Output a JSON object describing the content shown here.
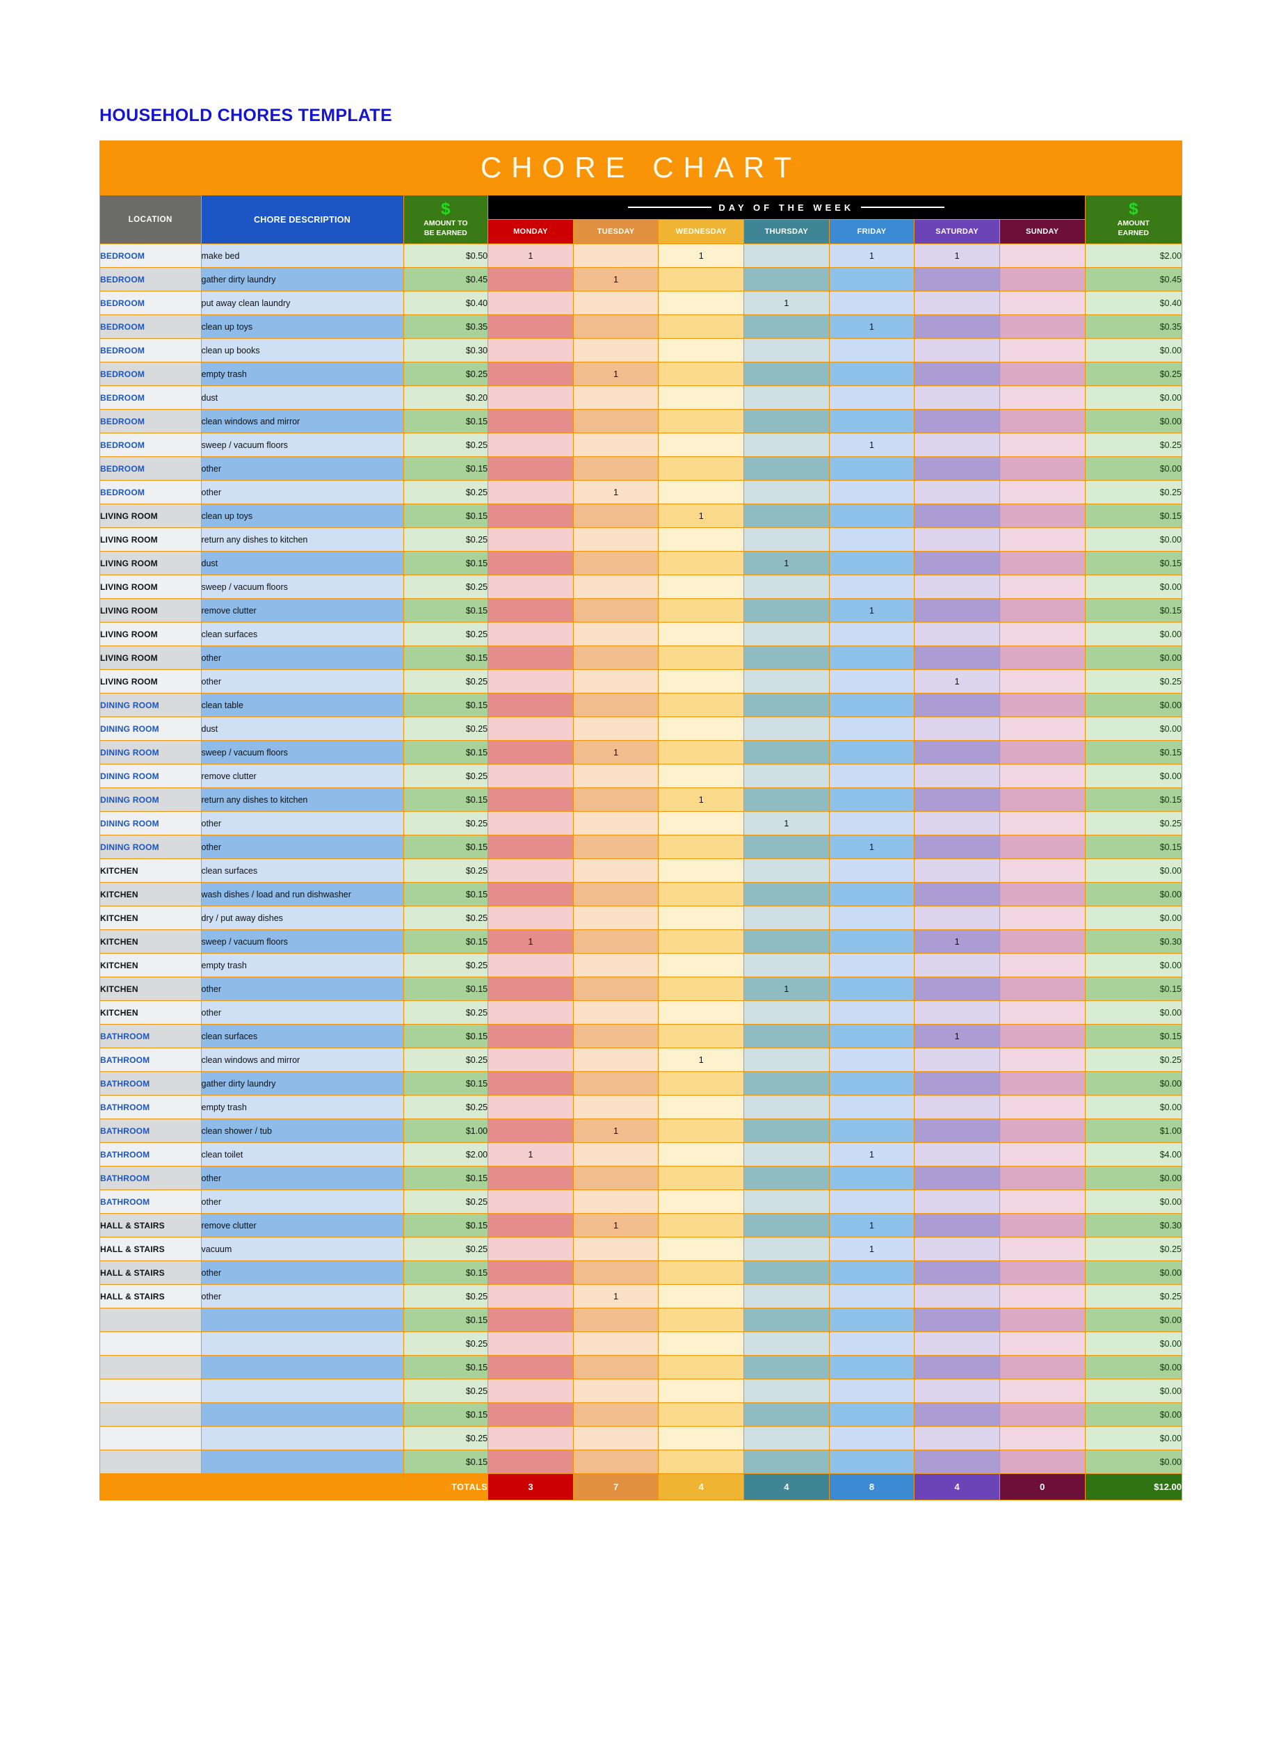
{
  "document": {
    "title": "HOUSEHOLD CHORES TEMPLATE",
    "banner_title": "CHORE CHART"
  },
  "colors": {
    "banner_orange": "#f89406",
    "title_blue": "#1414d2",
    "location_header_gray": "#6b6b68",
    "description_header_blue": "#1b56c4",
    "amount_header_green": "#3a7a16",
    "dollar_green": "#1fdd1f",
    "dayofweek_black": "#000000",
    "monday_red": "#cc0000",
    "tuesday_orange": "#e0903f",
    "wednesday_gold": "#f0b433",
    "thursday_teal": "#3f8596",
    "friday_blue": "#3b8bd4",
    "saturday_purple": "#6b45b8",
    "sunday_maroon": "#6d1039",
    "totals_green": "#2f7314"
  },
  "headers": {
    "location": "LOCATION",
    "chore_description": "CHORE DESCRIPTION",
    "amount_to_be_earned": [
      "AMOUNT TO",
      "BE EARNED"
    ],
    "day_of_the_week": "DAY OF THE WEEK",
    "amount_earned": [
      "AMOUNT",
      "EARNED"
    ],
    "dollar_symbol": "$",
    "days": [
      {
        "label": "MONDAY",
        "color": "#cc0000"
      },
      {
        "label": "TUESDAY",
        "color": "#e0903f"
      },
      {
        "label": "WEDNESDAY",
        "color": "#f0b433"
      },
      {
        "label": "THURSDAY",
        "color": "#3f8596"
      },
      {
        "label": "FRIDAY",
        "color": "#3b8bd4"
      },
      {
        "label": "SATURDAY",
        "color": "#6b45b8"
      },
      {
        "label": "SUNDAY",
        "color": "#6d1039"
      }
    ]
  },
  "totals": {
    "label": "TOTALS",
    "days": [
      "3",
      "7",
      "4",
      "4",
      "8",
      "4",
      "0"
    ],
    "amount_earned": "$12.00"
  },
  "rows": [
    {
      "location": "BEDROOM",
      "loc_color": "#1b56c4",
      "chore": "make bed",
      "amount": "$0.50",
      "days": [
        "1",
        "",
        "1",
        "",
        "1",
        "1",
        ""
      ],
      "earned": "$2.00"
    },
    {
      "location": "BEDROOM",
      "loc_color": "#1b56c4",
      "chore": "gather dirty laundry",
      "amount": "$0.45",
      "days": [
        "",
        "1",
        "",
        "",
        "",
        "",
        ""
      ],
      "earned": "$0.45"
    },
    {
      "location": "BEDROOM",
      "loc_color": "#1b56c4",
      "chore": "put away clean laundry",
      "amount": "$0.40",
      "days": [
        "",
        "",
        "",
        "1",
        "",
        "",
        ""
      ],
      "earned": "$0.40"
    },
    {
      "location": "BEDROOM",
      "loc_color": "#1b56c4",
      "chore": "clean up toys",
      "amount": "$0.35",
      "days": [
        "",
        "",
        "",
        "",
        "1",
        "",
        ""
      ],
      "earned": "$0.35"
    },
    {
      "location": "BEDROOM",
      "loc_color": "#1b56c4",
      "chore": "clean up books",
      "amount": "$0.30",
      "days": [
        "",
        "",
        "",
        "",
        "",
        "",
        ""
      ],
      "earned": "$0.00"
    },
    {
      "location": "BEDROOM",
      "loc_color": "#1b56c4",
      "chore": "empty trash",
      "amount": "$0.25",
      "days": [
        "",
        "1",
        "",
        "",
        "",
        "",
        ""
      ],
      "earned": "$0.25"
    },
    {
      "location": "BEDROOM",
      "loc_color": "#1b56c4",
      "chore": "dust",
      "amount": "$0.20",
      "days": [
        "",
        "",
        "",
        "",
        "",
        "",
        ""
      ],
      "earned": "$0.00"
    },
    {
      "location": "BEDROOM",
      "loc_color": "#1b56c4",
      "chore": "clean windows and mirror",
      "amount": "$0.15",
      "days": [
        "",
        "",
        "",
        "",
        "",
        "",
        ""
      ],
      "earned": "$0.00"
    },
    {
      "location": "BEDROOM",
      "loc_color": "#1b56c4",
      "chore": "sweep / vacuum floors",
      "amount": "$0.25",
      "days": [
        "",
        "",
        "",
        "",
        "1",
        "",
        ""
      ],
      "earned": "$0.25"
    },
    {
      "location": "BEDROOM",
      "loc_color": "#1b56c4",
      "chore": "other",
      "amount": "$0.15",
      "days": [
        "",
        "",
        "",
        "",
        "",
        "",
        ""
      ],
      "earned": "$0.00"
    },
    {
      "location": "BEDROOM",
      "loc_color": "#1b56c4",
      "chore": "other",
      "amount": "$0.25",
      "days": [
        "",
        "1",
        "",
        "",
        "",
        "",
        ""
      ],
      "earned": "$0.25"
    },
    {
      "location": "LIVING ROOM",
      "loc_color": "#111111",
      "chore": "clean up toys",
      "amount": "$0.15",
      "days": [
        "",
        "",
        "1",
        "",
        "",
        "",
        ""
      ],
      "earned": "$0.15"
    },
    {
      "location": "LIVING ROOM",
      "loc_color": "#111111",
      "chore": "return any dishes to kitchen",
      "amount": "$0.25",
      "days": [
        "",
        "",
        "",
        "",
        "",
        "",
        ""
      ],
      "earned": "$0.00"
    },
    {
      "location": "LIVING ROOM",
      "loc_color": "#111111",
      "chore": "dust",
      "amount": "$0.15",
      "days": [
        "",
        "",
        "",
        "1",
        "",
        "",
        ""
      ],
      "earned": "$0.15"
    },
    {
      "location": "LIVING ROOM",
      "loc_color": "#111111",
      "chore": "sweep / vacuum floors",
      "amount": "$0.25",
      "days": [
        "",
        "",
        "",
        "",
        "",
        "",
        ""
      ],
      "earned": "$0.00"
    },
    {
      "location": "LIVING ROOM",
      "loc_color": "#111111",
      "chore": "remove clutter",
      "amount": "$0.15",
      "days": [
        "",
        "",
        "",
        "",
        "1",
        "",
        ""
      ],
      "earned": "$0.15"
    },
    {
      "location": "LIVING ROOM",
      "loc_color": "#111111",
      "chore": "clean surfaces",
      "amount": "$0.25",
      "days": [
        "",
        "",
        "",
        "",
        "",
        "",
        ""
      ],
      "earned": "$0.00"
    },
    {
      "location": "LIVING ROOM",
      "loc_color": "#111111",
      "chore": "other",
      "amount": "$0.15",
      "days": [
        "",
        "",
        "",
        "",
        "",
        "",
        ""
      ],
      "earned": "$0.00"
    },
    {
      "location": "LIVING ROOM",
      "loc_color": "#111111",
      "chore": "other",
      "amount": "$0.25",
      "days": [
        "",
        "",
        "",
        "",
        "",
        "1",
        ""
      ],
      "earned": "$0.25"
    },
    {
      "location": "DINING ROOM",
      "loc_color": "#1b56c4",
      "chore": "clean table",
      "amount": "$0.15",
      "days": [
        "",
        "",
        "",
        "",
        "",
        "",
        ""
      ],
      "earned": "$0.00"
    },
    {
      "location": "DINING ROOM",
      "loc_color": "#1b56c4",
      "chore": "dust",
      "amount": "$0.25",
      "days": [
        "",
        "",
        "",
        "",
        "",
        "",
        ""
      ],
      "earned": "$0.00"
    },
    {
      "location": "DINING ROOM",
      "loc_color": "#1b56c4",
      "chore": "sweep / vacuum floors",
      "amount": "$0.15",
      "days": [
        "",
        "1",
        "",
        "",
        "",
        "",
        ""
      ],
      "earned": "$0.15"
    },
    {
      "location": "DINING ROOM",
      "loc_color": "#1b56c4",
      "chore": "remove clutter",
      "amount": "$0.25",
      "days": [
        "",
        "",
        "",
        "",
        "",
        "",
        ""
      ],
      "earned": "$0.00"
    },
    {
      "location": "DINING ROOM",
      "loc_color": "#1b56c4",
      "chore": "return any dishes to kitchen",
      "amount": "$0.15",
      "days": [
        "",
        "",
        "1",
        "",
        "",
        "",
        ""
      ],
      "earned": "$0.15"
    },
    {
      "location": "DINING ROOM",
      "loc_color": "#1b56c4",
      "chore": "other",
      "amount": "$0.25",
      "days": [
        "",
        "",
        "",
        "1",
        "",
        "",
        ""
      ],
      "earned": "$0.25"
    },
    {
      "location": "DINING ROOM",
      "loc_color": "#1b56c4",
      "chore": "other",
      "amount": "$0.15",
      "days": [
        "",
        "",
        "",
        "",
        "1",
        "",
        ""
      ],
      "earned": "$0.15"
    },
    {
      "location": "KITCHEN",
      "loc_color": "#111111",
      "chore": "clean surfaces",
      "amount": "$0.25",
      "days": [
        "",
        "",
        "",
        "",
        "",
        "",
        ""
      ],
      "earned": "$0.00"
    },
    {
      "location": "KITCHEN",
      "loc_color": "#111111",
      "chore": "wash dishes / load and run dishwasher",
      "amount": "$0.15",
      "days": [
        "",
        "",
        "",
        "",
        "",
        "",
        ""
      ],
      "earned": "$0.00"
    },
    {
      "location": "KITCHEN",
      "loc_color": "#111111",
      "chore": "dry / put away dishes",
      "amount": "$0.25",
      "days": [
        "",
        "",
        "",
        "",
        "",
        "",
        ""
      ],
      "earned": "$0.00"
    },
    {
      "location": "KITCHEN",
      "loc_color": "#111111",
      "chore": "sweep / vacuum floors",
      "amount": "$0.15",
      "days": [
        "1",
        "",
        "",
        "",
        "",
        "1",
        ""
      ],
      "earned": "$0.30"
    },
    {
      "location": "KITCHEN",
      "loc_color": "#111111",
      "chore": "empty trash",
      "amount": "$0.25",
      "days": [
        "",
        "",
        "",
        "",
        "",
        "",
        ""
      ],
      "earned": "$0.00"
    },
    {
      "location": "KITCHEN",
      "loc_color": "#111111",
      "chore": "other",
      "amount": "$0.15",
      "days": [
        "",
        "",
        "",
        "1",
        "",
        "",
        ""
      ],
      "earned": "$0.15"
    },
    {
      "location": "KITCHEN",
      "loc_color": "#111111",
      "chore": "other",
      "amount": "$0.25",
      "days": [
        "",
        "",
        "",
        "",
        "",
        "",
        ""
      ],
      "earned": "$0.00"
    },
    {
      "location": "BATHROOM",
      "loc_color": "#1b56c4",
      "chore": "clean surfaces",
      "amount": "$0.15",
      "days": [
        "",
        "",
        "",
        "",
        "",
        "1",
        ""
      ],
      "earned": "$0.15"
    },
    {
      "location": "BATHROOM",
      "loc_color": "#1b56c4",
      "chore": "clean windows and mirror",
      "amount": "$0.25",
      "days": [
        "",
        "",
        "1",
        "",
        "",
        "",
        ""
      ],
      "earned": "$0.25"
    },
    {
      "location": "BATHROOM",
      "loc_color": "#1b56c4",
      "chore": "gather dirty laundry",
      "amount": "$0.15",
      "days": [
        "",
        "",
        "",
        "",
        "",
        "",
        ""
      ],
      "earned": "$0.00"
    },
    {
      "location": "BATHROOM",
      "loc_color": "#1b56c4",
      "chore": "empty trash",
      "amount": "$0.25",
      "days": [
        "",
        "",
        "",
        "",
        "",
        "",
        ""
      ],
      "earned": "$0.00"
    },
    {
      "location": "BATHROOM",
      "loc_color": "#1b56c4",
      "chore": "clean shower / tub",
      "amount": "$1.00",
      "days": [
        "",
        "1",
        "",
        "",
        "",
        "",
        ""
      ],
      "earned": "$1.00"
    },
    {
      "location": "BATHROOM",
      "loc_color": "#1b56c4",
      "chore": "clean toilet",
      "amount": "$2.00",
      "days": [
        "1",
        "",
        "",
        "",
        "1",
        "",
        ""
      ],
      "earned": "$4.00"
    },
    {
      "location": "BATHROOM",
      "loc_color": "#1b56c4",
      "chore": "other",
      "amount": "$0.15",
      "days": [
        "",
        "",
        "",
        "",
        "",
        "",
        ""
      ],
      "earned": "$0.00"
    },
    {
      "location": "BATHROOM",
      "loc_color": "#1b56c4",
      "chore": "other",
      "amount": "$0.25",
      "days": [
        "",
        "",
        "",
        "",
        "",
        "",
        ""
      ],
      "earned": "$0.00"
    },
    {
      "location": "HALL & STAIRS",
      "loc_color": "#111111",
      "chore": "remove clutter",
      "amount": "$0.15",
      "days": [
        "",
        "1",
        "",
        "",
        "1",
        "",
        ""
      ],
      "earned": "$0.30"
    },
    {
      "location": "HALL & STAIRS",
      "loc_color": "#111111",
      "chore": "vacuum",
      "amount": "$0.25",
      "days": [
        "",
        "",
        "",
        "",
        "1",
        "",
        ""
      ],
      "earned": "$0.25"
    },
    {
      "location": "HALL & STAIRS",
      "loc_color": "#111111",
      "chore": "other",
      "amount": "$0.15",
      "days": [
        "",
        "",
        "",
        "",
        "",
        "",
        ""
      ],
      "earned": "$0.00"
    },
    {
      "location": "HALL & STAIRS",
      "loc_color": "#111111",
      "chore": "other",
      "amount": "$0.25",
      "days": [
        "",
        "1",
        "",
        "",
        "",
        "",
        ""
      ],
      "earned": "$0.25"
    },
    {
      "location": "",
      "loc_color": "#111111",
      "chore": "",
      "amount": "$0.15",
      "days": [
        "",
        "",
        "",
        "",
        "",
        "",
        ""
      ],
      "earned": "$0.00"
    },
    {
      "location": "",
      "loc_color": "#111111",
      "chore": "",
      "amount": "$0.25",
      "days": [
        "",
        "",
        "",
        "",
        "",
        "",
        ""
      ],
      "earned": "$0.00"
    },
    {
      "location": "",
      "loc_color": "#111111",
      "chore": "",
      "amount": "$0.15",
      "days": [
        "",
        "",
        "",
        "",
        "",
        "",
        ""
      ],
      "earned": "$0.00"
    },
    {
      "location": "",
      "loc_color": "#111111",
      "chore": "",
      "amount": "$0.25",
      "days": [
        "",
        "",
        "",
        "",
        "",
        "",
        ""
      ],
      "earned": "$0.00"
    },
    {
      "location": "",
      "loc_color": "#111111",
      "chore": "",
      "amount": "$0.15",
      "days": [
        "",
        "",
        "",
        "",
        "",
        "",
        ""
      ],
      "earned": "$0.00"
    },
    {
      "location": "",
      "loc_color": "#111111",
      "chore": "",
      "amount": "$0.25",
      "days": [
        "",
        "",
        "",
        "",
        "",
        "",
        ""
      ],
      "earned": "$0.00"
    },
    {
      "location": "",
      "loc_color": "#111111",
      "chore": "",
      "amount": "$0.15",
      "days": [
        "",
        "",
        "",
        "",
        "",
        "",
        ""
      ],
      "earned": "$0.00"
    }
  ]
}
